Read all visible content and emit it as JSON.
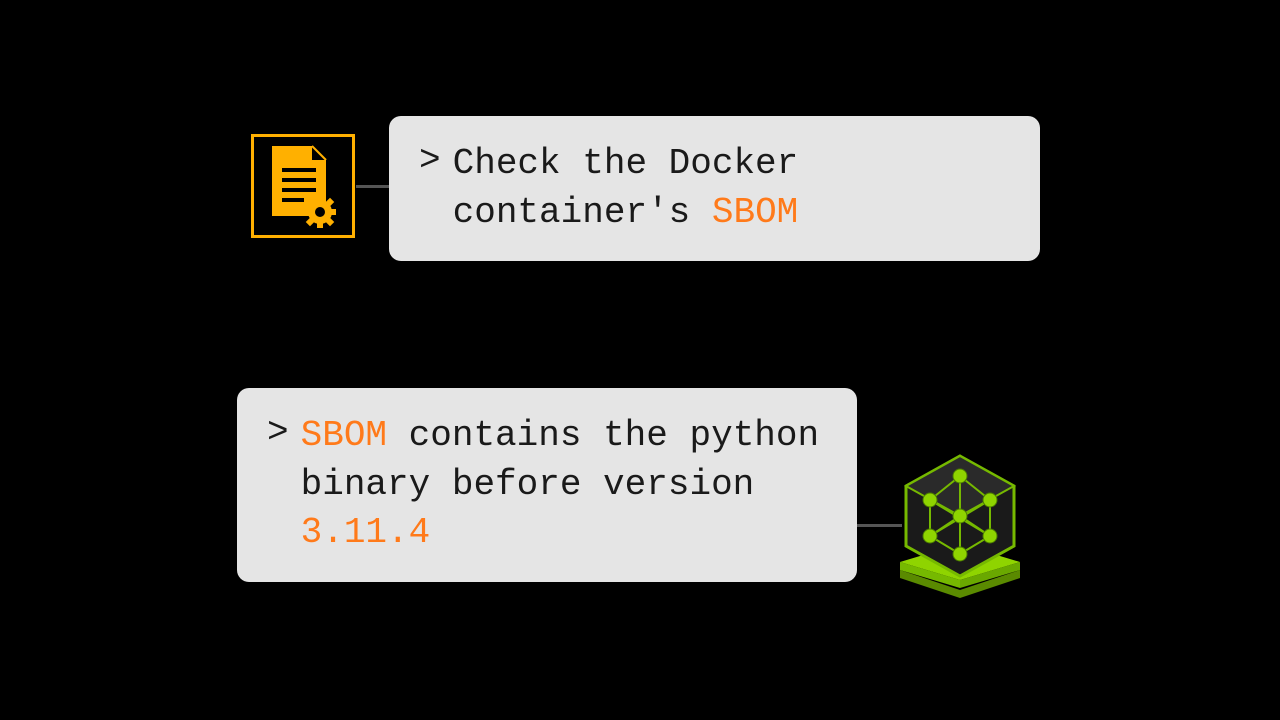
{
  "colors": {
    "highlight": "#ff7a1a",
    "docIcon": "#ffb000",
    "netIcon": "#76b900"
  },
  "card1": {
    "prefix": "Check the Docker container's ",
    "highlight": "SBOM"
  },
  "card2": {
    "highlight1": "SBOM",
    "mid": " contains the python binary before version ",
    "highlight2": "3.11.4"
  }
}
